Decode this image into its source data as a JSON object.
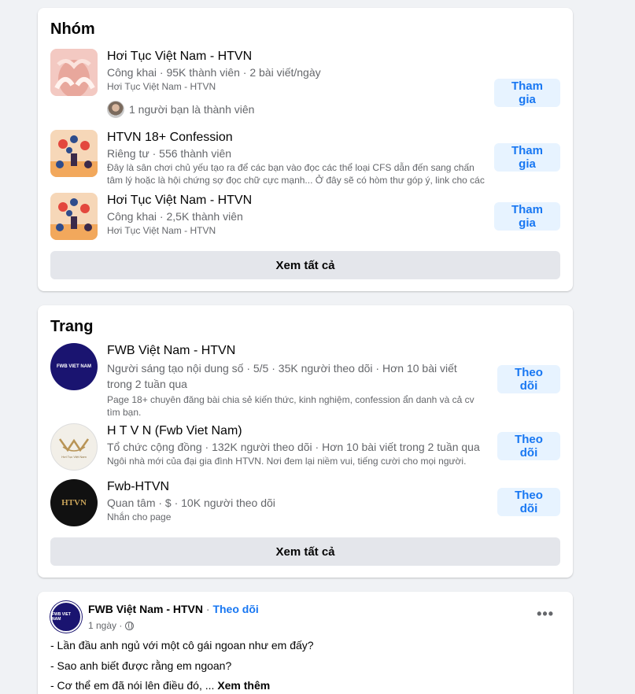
{
  "groups": {
    "title": "Nhóm",
    "items": [
      {
        "name": "Hơi Tục Việt Nam - HTVN",
        "meta": "Công khai · 95K thành viên · 2 bài viết/ngày",
        "desc": "Hơi Tục Việt Nam - HTVN",
        "friends": "1 người bạn là thành viên",
        "button": "Tham gia"
      },
      {
        "name": "HTVN 18+ Confession",
        "meta": "Riêng tư · 556 thành viên",
        "desc": "Đây là sân chơi chủ yếu tạo ra để các bạn vào đọc các thể loại CFS dẫn đến sang chấn tâm lý hoặc là hội chứng sợ đọc chữ cực mạnh... Ở đây sẽ có hòm thư góp ý, link cho các bạn...",
        "button": "Tham gia"
      },
      {
        "name": "Hơi Tục Việt Nam - HTVN",
        "meta": "Công khai · 2,5K thành viên",
        "desc": "Hơi Tục Việt Nam - HTVN",
        "button": "Tham gia"
      }
    ],
    "see_all": "Xem tất cả"
  },
  "pages": {
    "title": "Trang",
    "items": [
      {
        "name": "FWB Việt Nam - HTVN",
        "meta": "Người sáng tạo nội dung số · 5/5 · 35K người theo dõi · Hơn 10 bài viết trong 2 tuần qua",
        "desc": "Page 18+ chuyên đăng bài chia sẻ kiến thức, kinh nghiệm, confession ẩn danh và cả cv tìm bạn.",
        "avatar_text": "FWB VIET NAM",
        "button": "Theo dõi"
      },
      {
        "name": "H T V N (Fwb Viet Nam)",
        "meta": "Tổ chức cộng đồng · 132K người theo dõi · Hơn 10 bài viết trong 2 tuần qua",
        "desc": "Ngôi nhà mới của đại gia đình HTVN. Nơi đem lại niềm vui, tiếng cười cho mọi người.",
        "avatar_text": "Hơi Tục Việt Nam",
        "button": "Theo dõi"
      },
      {
        "name": "Fwb-HTVN",
        "meta": "Quan tâm · $ · 10K người theo dõi",
        "desc": "Nhắn cho page",
        "avatar_text": "HTVN",
        "button": "Theo dõi"
      }
    ],
    "see_all": "Xem tất cả"
  },
  "post": {
    "author": "FWB Việt Nam - HTVN",
    "separator": "·",
    "follow": "Theo dõi",
    "time": "1 ngày ·",
    "avatar_text": "FWB VIET NAM",
    "lines": [
      "- Lần đầu anh ngủ với một cô gái ngoan như em đấy?",
      "- Sao anh biết được rằng em ngoan?",
      "- Cơ thể em đã nói lên điều đó, ..."
    ],
    "see_more": "Xem thêm"
  },
  "colors": {
    "background": "#f0f2f5",
    "accent": "#1877f2",
    "button_light": "#e7f3ff",
    "button_gray": "#e4e6eb",
    "secondary_text": "#65676b"
  }
}
